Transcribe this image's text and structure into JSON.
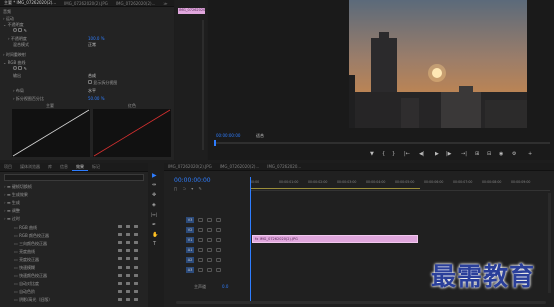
{
  "source_tabs": {
    "items": [
      "主要 * IMG_07262020(2)...",
      "IMG_07262020(2).JPG",
      "IMG_07262020(2)..."
    ],
    "close_label": "×",
    "overflow_label": "≫"
  },
  "effect_controls": {
    "top_label": "音频",
    "sections": [
      {
        "label": "运动",
        "value": ""
      },
      {
        "label": "不透明度",
        "value": ""
      },
      {
        "label": "不透明度",
        "value": "100.0 %"
      },
      {
        "label": "混合模式",
        "value": "正常"
      },
      {
        "label": "时间重映射",
        "value": ""
      },
      {
        "label": "RGB 曲线",
        "value": ""
      },
      {
        "label": "输出",
        "value": "合成"
      },
      {
        "label": "显示拆分视图",
        "value": ""
      },
      {
        "label": "布局",
        "value": "水平"
      },
      {
        "label": "拆分视图百分比",
        "value": "50.00 %"
      }
    ],
    "curve_labels": [
      "主要",
      "红色"
    ]
  },
  "clip_tag": "IMG_07262020",
  "program_monitor": {
    "timecode": "00:00:00:00",
    "fit_label": "适合",
    "transport": [
      "▼",
      "{",
      "}",
      "|←",
      "◀|",
      "▶",
      "|▶",
      "→|",
      "⊞",
      "⊟",
      "◉",
      "⚙",
      "+"
    ]
  },
  "project_panel": {
    "tabs": [
      "项目",
      "媒体浏览器",
      "库",
      "信息",
      "效果",
      "标记"
    ],
    "active_tab": "效果",
    "items": [
      {
        "label": "键帧切换帧",
        "indent": 0
      },
      {
        "label": "生成效果",
        "indent": 0
      },
      {
        "label": "生成",
        "indent": 0
      },
      {
        "label": "调整",
        "indent": 0
      },
      {
        "label": "过时",
        "indent": 0
      },
      {
        "label": "RGB 曲线",
        "indent": 1
      },
      {
        "label": "RGB 颜色校正器",
        "indent": 1
      },
      {
        "label": "三向颜色校正器",
        "indent": 1
      },
      {
        "label": "亮度曲线",
        "indent": 1
      },
      {
        "label": "亮度校正器",
        "indent": 1
      },
      {
        "label": "快速模糊",
        "indent": 1
      },
      {
        "label": "快速颜色校正器",
        "indent": 1
      },
      {
        "label": "自动对比度",
        "indent": 1
      },
      {
        "label": "自动色阶",
        "indent": 1
      },
      {
        "label": "阴影/高光（旧版）",
        "indent": 1
      }
    ]
  },
  "tools": [
    "▶",
    "⇹",
    "✥",
    "◈",
    "|↔|",
    "✒",
    "✋",
    "T"
  ],
  "timeline": {
    "tabs": [
      "IMG_07262020(2).JPG",
      "IMG_07262020(2)...",
      "IMG_07262020..."
    ],
    "timecode": "00:00:00:00",
    "ruler_marks": [
      "00:00",
      "00:00:01:00",
      "00:00:02:00",
      "00:00:03:00",
      "00:00:04:00",
      "00:00:05:00",
      "00:00:06:00",
      "00:00:07:00",
      "00:00:08:00",
      "00:00:09:00"
    ],
    "video_tracks": [
      "V3",
      "V2",
      "V1"
    ],
    "audio_tracks": [
      "A1",
      "A2",
      "A3"
    ],
    "master_label": "主声道",
    "master_value": "0.0",
    "clip_label": "IMG_07262020(2).JPG",
    "clip_color": "#e0a7dd"
  },
  "watermark": "最需教育",
  "colors": {
    "accent_blue": "#2e7dff",
    "clip_pink": "#e0a7dd"
  }
}
